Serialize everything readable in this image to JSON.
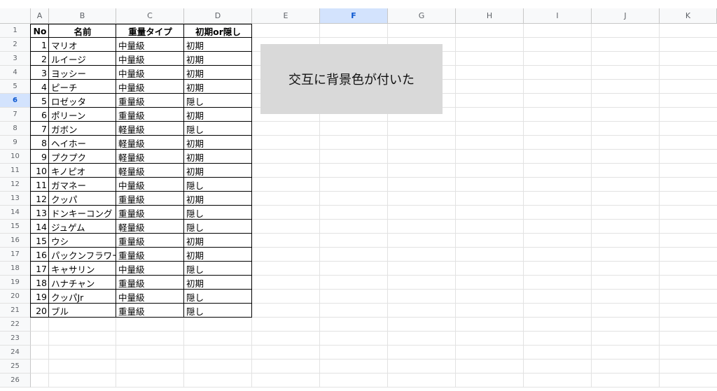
{
  "columns": [
    "A",
    "B",
    "C",
    "D",
    "E",
    "F",
    "G",
    "H",
    "I",
    "J",
    "K"
  ],
  "selected_column": "F",
  "rows": [
    "1",
    "2",
    "3",
    "4",
    "5",
    "6",
    "7",
    "8",
    "9",
    "10",
    "11",
    "12",
    "13",
    "14",
    "15",
    "16",
    "17",
    "18",
    "19",
    "20",
    "21",
    "22",
    "23",
    "24",
    "25",
    "26"
  ],
  "selected_row": "6",
  "table": {
    "headers": [
      "No",
      "名前",
      "重量タイプ",
      "初期or隠し"
    ],
    "rows": [
      [
        "1",
        "マリオ",
        "中量級",
        "初期"
      ],
      [
        "2",
        "ルイージ",
        "中量級",
        "初期"
      ],
      [
        "3",
        "ヨッシー",
        "中量級",
        "初期"
      ],
      [
        "4",
        "ピーチ",
        "中量級",
        "初期"
      ],
      [
        "5",
        "ロゼッタ",
        "重量級",
        "隠し"
      ],
      [
        "6",
        "ポリーン",
        "重量級",
        "初期"
      ],
      [
        "7",
        "ガボン",
        "軽量級",
        "隠し"
      ],
      [
        "8",
        "ヘイホー",
        "軽量級",
        "初期"
      ],
      [
        "9",
        "プクプク",
        "軽量級",
        "初期"
      ],
      [
        "10",
        "キノピオ",
        "軽量級",
        "初期"
      ],
      [
        "11",
        "ガマネー",
        "中量級",
        "隠し"
      ],
      [
        "12",
        "クッパ",
        "重量級",
        "初期"
      ],
      [
        "13",
        "ドンキーコング",
        "重量級",
        "隠し"
      ],
      [
        "14",
        "ジュゲム",
        "軽量級",
        "隠し"
      ],
      [
        "15",
        "ウシ",
        "重量級",
        "初期"
      ],
      [
        "16",
        "パックンフラワー",
        "重量級",
        "初期"
      ],
      [
        "17",
        "キャサリン",
        "中量級",
        "隠し"
      ],
      [
        "18",
        "ハナチャン",
        "重量級",
        "初期"
      ],
      [
        "19",
        "クッパJr",
        "中量級",
        "隠し"
      ],
      [
        "20",
        "ブル",
        "重量級",
        "隠し"
      ]
    ]
  },
  "shape_text": "交互に背景色が付いた"
}
